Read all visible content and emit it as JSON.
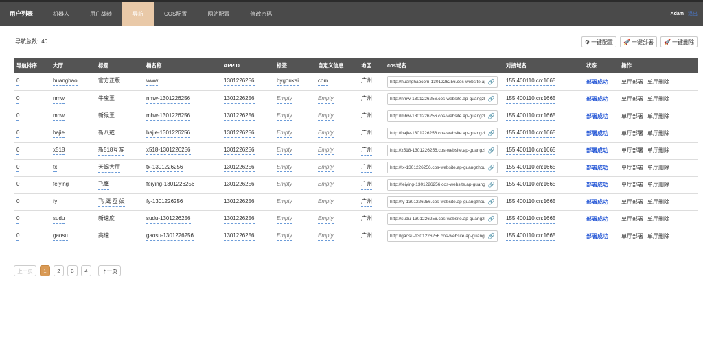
{
  "nav": {
    "brand": "用户列表",
    "items": [
      "机器人",
      "用户战绩",
      "导航",
      "COS配置",
      "网站配置",
      "修改密码"
    ],
    "active_index": 2,
    "user": "Adam",
    "logout": "退出"
  },
  "toolbar": {
    "count_label": "导航总数:",
    "count_value": "40",
    "config_label": "一键配置",
    "deploy_label": "一键部署",
    "delete_label": "一键删除"
  },
  "table": {
    "headers": [
      "导航排序",
      "大厅",
      "标题",
      "桶名称",
      "APPID",
      "标签",
      "自定义信息",
      "地区",
      "cos域名",
      "对接域名",
      "状态",
      "操作"
    ],
    "rows": [
      {
        "sort": "0",
        "hall": "huanghao",
        "title": "官方正版",
        "bucket": "www",
        "appid": "1301226256",
        "tag": "bygoukai",
        "info": "com",
        "region": "广州",
        "cos": "http://huanghaocom-1301226256.cos-website.ap-guangzhou.myqcloud.com",
        "domain": "155.400110.cn:1665",
        "status": "部署成功",
        "op1": "单厅部署",
        "op2": "单厅删除"
      },
      {
        "sort": "0",
        "hall": "nmw",
        "title": "牛魔王",
        "bucket": "nmw-1301226256",
        "appid": "1301226256",
        "tag": "Empty",
        "info": "Empty",
        "region": "广州",
        "cos": "http://nmw-1301226256.cos-website.ap-guangzhou.myqcloud.com",
        "domain": "155.400110.cn:1665",
        "status": "部署成功",
        "op1": "单厅部署",
        "op2": "单厅删除"
      },
      {
        "sort": "0",
        "hall": "mhw",
        "title": "新猴王",
        "bucket": "mhw-1301226256",
        "appid": "1301226256",
        "tag": "Empty",
        "info": "Empty",
        "region": "广州",
        "cos": "http://mhw-1301226256.cos-website.ap-guangzhou.myqcloud.com",
        "domain": "155.400110.cn:1665",
        "status": "部署成功",
        "op1": "单厅部署",
        "op2": "单厅删除"
      },
      {
        "sort": "0",
        "hall": "bajie",
        "title": "新八戒",
        "bucket": "bajie-1301226256",
        "appid": "1301226256",
        "tag": "Empty",
        "info": "Empty",
        "region": "广州",
        "cos": "http://bajie-1301226256.cos-website.ap-guangzhou.myqcloud.com",
        "domain": "155.400110.cn:1665",
        "status": "部署成功",
        "op1": "单厅部署",
        "op2": "单厅删除"
      },
      {
        "sort": "0",
        "hall": "x518",
        "title": "新518互游",
        "bucket": "x518-1301226256",
        "appid": "1301226256",
        "tag": "Empty",
        "info": "Empty",
        "region": "广州",
        "cos": "http://x518-1301226256.cos-website.ap-guangzhou.myqcloud.com",
        "domain": "155.400110.cn:1665",
        "status": "部署成功",
        "op1": "单厅部署",
        "op2": "单厅删除"
      },
      {
        "sort": "0",
        "hall": "tx",
        "title": "天蝎大厅",
        "bucket": "tx-1301226256",
        "appid": "1301226256",
        "tag": "Empty",
        "info": "Empty",
        "region": "广州",
        "cos": "http://tx-1301226256.cos-website.ap-guangzhou.myqcloud.com",
        "domain": "155.400110.cn:1665",
        "status": "部署成功",
        "op1": "单厅部署",
        "op2": "单厅删除"
      },
      {
        "sort": "0",
        "hall": "feiying",
        "title": "飞鹰",
        "bucket": "feiying-1301226256",
        "appid": "1301226256",
        "tag": "Empty",
        "info": "Empty",
        "region": "广州",
        "cos": "http://feiying-1301226256.cos-website.ap-guangzhou.myqcloud.com",
        "domain": "155.400110.cn:1665",
        "status": "部署成功",
        "op1": "单厅部署",
        "op2": "单厅删除"
      },
      {
        "sort": "0",
        "hall": "fy",
        "title": "飞 鹰 互 娱",
        "bucket": "fy-1301226256",
        "appid": "1301226256",
        "tag": "Empty",
        "info": "Empty",
        "region": "广州",
        "cos": "http://fy-1301226256.cos-website.ap-guangzhou.myqcloud.com",
        "domain": "155.400110.cn:1665",
        "status": "部署成功",
        "op1": "单厅部署",
        "op2": "单厅删除"
      },
      {
        "sort": "0",
        "hall": "sudu",
        "title": "新速度",
        "bucket": "sudu-1301226256",
        "appid": "1301226256",
        "tag": "Empty",
        "info": "Empty",
        "region": "广州",
        "cos": "http://sudu-1301226256.cos-website.ap-guangzhou.myqcloud.com",
        "domain": "155.400110.cn:1665",
        "status": "部署成功",
        "op1": "单厅部署",
        "op2": "单厅删除"
      },
      {
        "sort": "0",
        "hall": "gaosu",
        "title": "高速",
        "bucket": "gaosu-1301226256",
        "appid": "1301226256",
        "tag": "Empty",
        "info": "Empty",
        "region": "广州",
        "cos": "http://gaosu-1301226256.cos-website.ap-guangzhou.myqcloud.com",
        "domain": "155.400110.cn:1665",
        "status": "部署成功",
        "op1": "单厅部署",
        "op2": "单厅删除"
      }
    ]
  },
  "pager": {
    "prev": "上一页",
    "pages": [
      "1",
      "2",
      "3",
      "4"
    ],
    "active_page": "1",
    "next": "下一页"
  },
  "colors": {
    "navbar": "#4a4a4a",
    "nav_active": "#e9c9a8",
    "table_header": "#545454",
    "status": "#2a5bd7",
    "page_active": "#d99a55"
  },
  "icons": {
    "config": "cogs-icon",
    "deploy": "rocket-icon",
    "delete": "rocket-icon",
    "copy": "link-icon"
  }
}
